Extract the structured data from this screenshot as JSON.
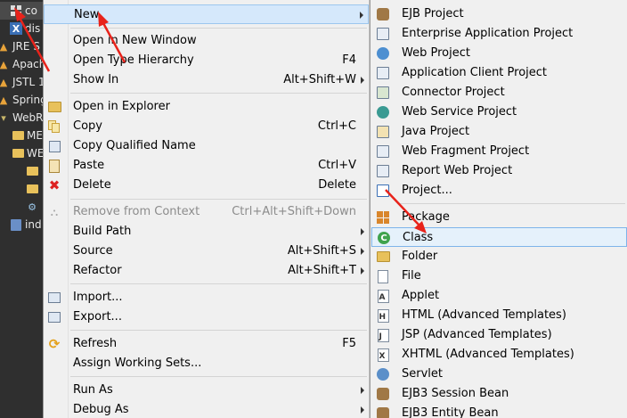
{
  "explorer": {
    "rows": [
      {
        "label": "co",
        "icon": "project-grid-icon"
      },
      {
        "label": "dis",
        "icon": "xml-file-icon"
      },
      {
        "label": "JRE S",
        "icon": "library-icon"
      },
      {
        "label": "Apach",
        "icon": "library-icon"
      },
      {
        "label": "JSTL 1",
        "icon": "library-icon"
      },
      {
        "label": "Spring",
        "icon": "library-icon"
      },
      {
        "label": "WebR",
        "icon": "web-root-icon"
      },
      {
        "label": "ME",
        "icon": "folder-icon"
      },
      {
        "label": "WE",
        "icon": "folder-icon"
      },
      {
        "label": "",
        "icon": "folder-icon"
      },
      {
        "label": "",
        "icon": "folder-icon"
      },
      {
        "label": "",
        "icon": "gear-file-icon"
      },
      {
        "label": "ind",
        "icon": "jsp-file-icon"
      }
    ]
  },
  "context_menu": {
    "new": {
      "label": "New"
    },
    "open_new_window": {
      "label": "Open in New Window"
    },
    "open_type_hierarchy": {
      "label": "Open Type Hierarchy",
      "shortcut": "F4"
    },
    "show_in": {
      "label": "Show In",
      "shortcut": "Alt+Shift+W"
    },
    "open_in_explorer": {
      "label": "Open in Explorer"
    },
    "copy": {
      "label": "Copy",
      "shortcut": "Ctrl+C"
    },
    "copy_qualified_name": {
      "label": "Copy Qualified Name"
    },
    "paste": {
      "label": "Paste",
      "shortcut": "Ctrl+V"
    },
    "delete": {
      "label": "Delete",
      "shortcut": "Delete"
    },
    "remove_from_context": {
      "label": "Remove from Context",
      "shortcut": "Ctrl+Alt+Shift+Down"
    },
    "build_path": {
      "label": "Build Path"
    },
    "source": {
      "label": "Source",
      "shortcut": "Alt+Shift+S"
    },
    "refactor": {
      "label": "Refactor",
      "shortcut": "Alt+Shift+T"
    },
    "import": {
      "label": "Import..."
    },
    "export": {
      "label": "Export..."
    },
    "refresh": {
      "label": "Refresh",
      "shortcut": "F5"
    },
    "assign_working_sets": {
      "label": "Assign Working Sets..."
    },
    "run_as": {
      "label": "Run As"
    },
    "debug_as": {
      "label": "Debug As"
    }
  },
  "submenu": {
    "items": [
      {
        "label": "EJB Project",
        "icon": "ejb-project-icon"
      },
      {
        "label": "Enterprise Application Project",
        "icon": "ear-project-icon"
      },
      {
        "label": "Web Project",
        "icon": "web-project-icon"
      },
      {
        "label": "Application Client Project",
        "icon": "app-client-project-icon"
      },
      {
        "label": "Connector Project",
        "icon": "connector-project-icon"
      },
      {
        "label": "Web Service Project",
        "icon": "web-service-project-icon"
      },
      {
        "label": "Java Project",
        "icon": "java-project-icon"
      },
      {
        "label": "Web Fragment Project",
        "icon": "web-fragment-project-icon"
      },
      {
        "label": "Report Web Project",
        "icon": "report-web-project-icon"
      },
      {
        "label": "Project...",
        "icon": "new-project-icon"
      },
      {
        "label": "Package",
        "icon": "package-icon"
      },
      {
        "label": "Class",
        "icon": "class-icon"
      },
      {
        "label": "Folder",
        "icon": "folder-icon"
      },
      {
        "label": "File",
        "icon": "file-icon"
      },
      {
        "label": "Applet",
        "icon": "applet-icon"
      },
      {
        "label": "HTML (Advanced Templates)",
        "icon": "html-file-icon"
      },
      {
        "label": "JSP (Advanced Templates)",
        "icon": "jsp-file-icon"
      },
      {
        "label": "XHTML (Advanced Templates)",
        "icon": "xhtml-file-icon"
      },
      {
        "label": "Servlet",
        "icon": "servlet-icon"
      },
      {
        "label": "EJB3 Session Bean",
        "icon": "session-bean-icon"
      },
      {
        "label": "EJB3 Entity Bean",
        "icon": "entity-bean-icon"
      }
    ]
  },
  "colors": {
    "annotation_arrow": "#e8231b",
    "menu_bg": "#f0f0f0",
    "highlight_bg": "#e5f1fb",
    "highlight_border": "#7eb4ea",
    "explorer_bg": "#2f2f2f"
  }
}
